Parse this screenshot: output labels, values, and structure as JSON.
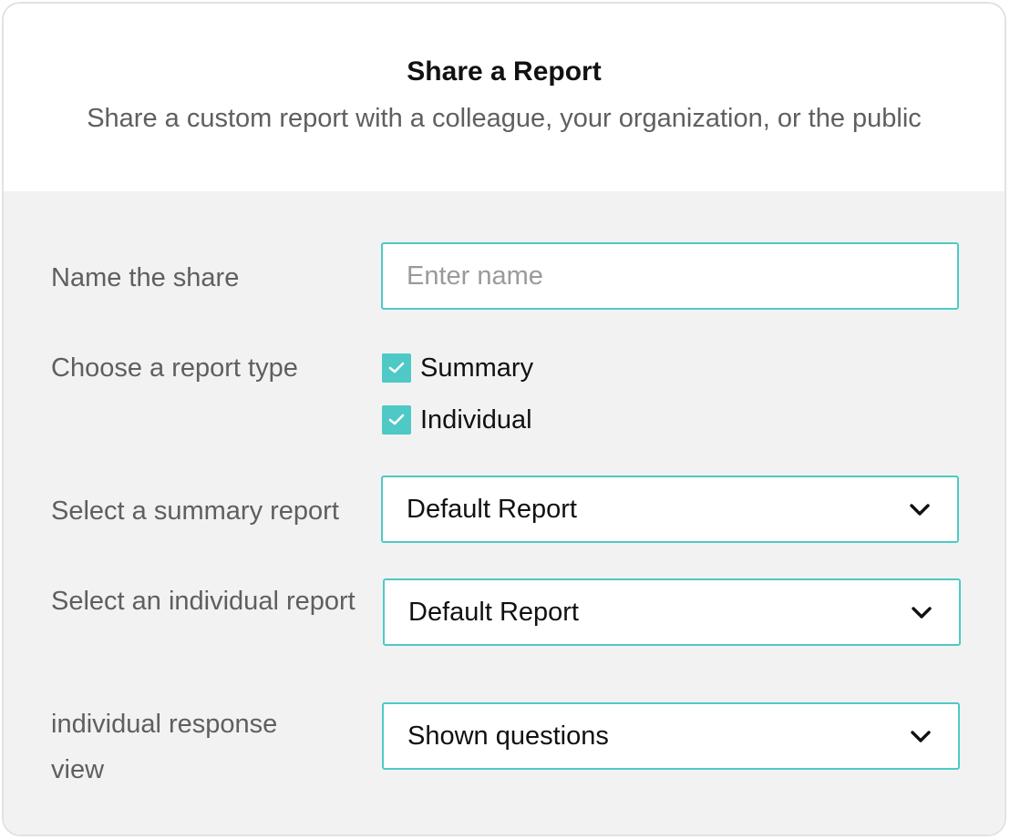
{
  "dialog": {
    "title": "Share a Report",
    "subtitle": "Share a custom report with a colleague, your organization,  or the public"
  },
  "form": {
    "name": {
      "label": "Name the share",
      "placeholder": "Enter name",
      "value": ""
    },
    "report_type": {
      "label": "Choose a report type",
      "options": [
        {
          "label": "Summary",
          "checked": true
        },
        {
          "label": "Individual",
          "checked": true
        }
      ]
    },
    "summary_report": {
      "label": "Select a summary report",
      "selected": "Default Report"
    },
    "individual_report": {
      "label": "Select an individual report",
      "selected": "Default Report"
    },
    "response_view": {
      "label": "individual response view",
      "selected": "Shown questions"
    }
  },
  "colors": {
    "accent": "#4ec9c6",
    "body_background": "#f2f2f2",
    "label_text": "#5f5f5f"
  },
  "icons": {
    "checkbox_mark": "check-icon",
    "dropdown": "chevron-down-icon"
  }
}
